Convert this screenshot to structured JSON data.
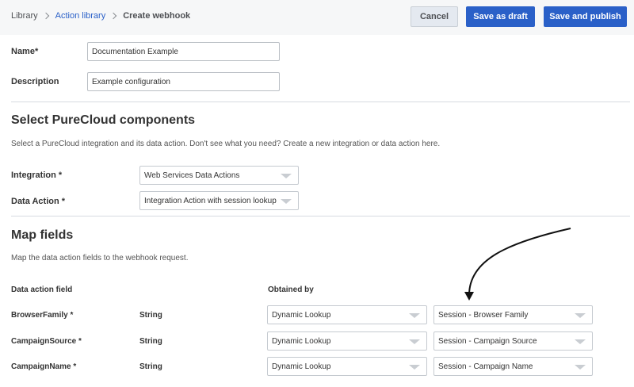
{
  "breadcrumb": {
    "library": "Library",
    "action_library": "Action library",
    "current": "Create webhook"
  },
  "toolbar": {
    "cancel": "Cancel",
    "save_draft": "Save as draft",
    "save_publish": "Save and publish"
  },
  "form": {
    "name_label": "Name*",
    "name_value": "Documentation Example",
    "description_label": "Description",
    "description_value": "Example configuration"
  },
  "components": {
    "title": "Select PureCloud components",
    "description": "Select a PureCloud integration and its data action. Don't see what you need? Create a new integration or data action here.",
    "integration_label": "Integration *",
    "integration_value": "Web Services Data Actions",
    "data_action_label": "Data Action *",
    "data_action_value": "Integration Action with session lookup"
  },
  "map": {
    "title": "Map fields",
    "description": "Map the data action fields to the webhook request.",
    "col_field": "Data action field",
    "col_obtained": "Obtained by",
    "rows": [
      {
        "field": "BrowserFamily *",
        "type": "String",
        "method": "Dynamic Lookup",
        "value": "Session - Browser Family"
      },
      {
        "field": "CampaignSource *",
        "type": "String",
        "method": "Dynamic Lookup",
        "value": "Session - Campaign Source"
      },
      {
        "field": "CampaignName *",
        "type": "String",
        "method": "Dynamic Lookup",
        "value": "Session - Campaign Name"
      }
    ]
  },
  "icons": {
    "breadcrumb_separator": "chevron-right-icon",
    "select_caret": "caret-down-icon",
    "annotation": "curved-arrow"
  }
}
